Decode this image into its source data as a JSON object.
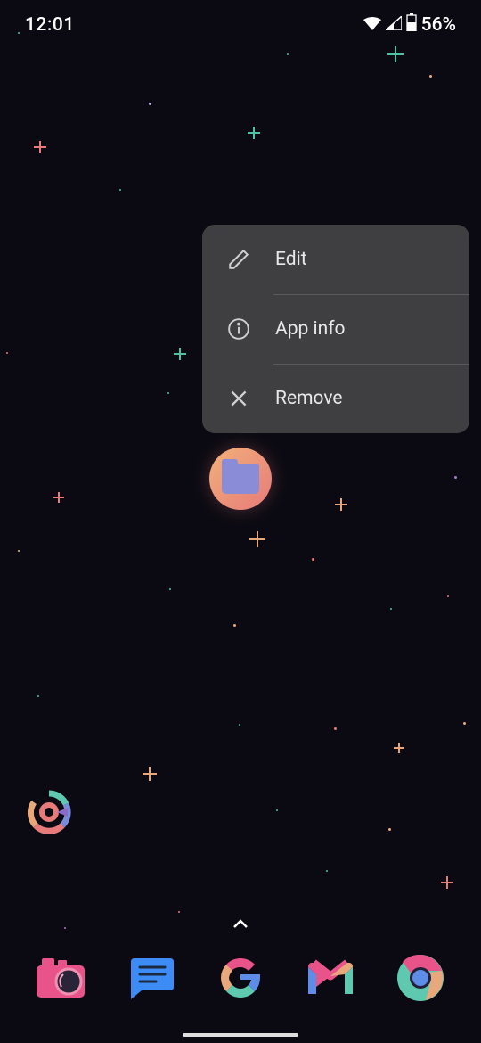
{
  "status": {
    "time": "12:01",
    "battery_percent": "56%"
  },
  "context_menu": {
    "edit_label": "Edit",
    "app_info_label": "App info",
    "remove_label": "Remove"
  },
  "dock": {
    "items": [
      {
        "name": "camera"
      },
      {
        "name": "messages"
      },
      {
        "name": "google"
      },
      {
        "name": "gmail"
      },
      {
        "name": "chrome"
      }
    ]
  }
}
